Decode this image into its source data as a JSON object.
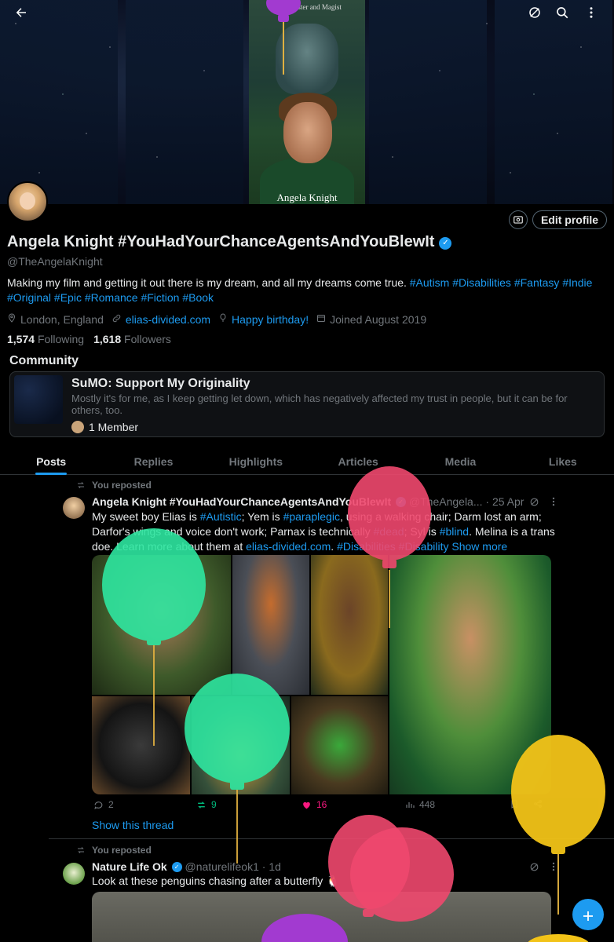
{
  "banner": {
    "book_title": "Elias\nMaster and Magist",
    "book_author": "Angela Knight"
  },
  "profile": {
    "name": "Angela Knight #YouHadYourChanceAgentsAndYouBlewIt",
    "handle": "@TheAngelaKnight",
    "edit_label": "Edit profile",
    "bio": "Making my film and getting it out there is my dream, and all my dreams come true.",
    "bio_tags": [
      "#Autism",
      "#Disabilities",
      "#Fantasy",
      "#Indie",
      "#Original",
      "#Epic",
      "#Romance",
      "#Fiction",
      "#Book"
    ],
    "location": "London, England",
    "website": "elias-divided.com",
    "birthday": "Happy birthday!",
    "joined": "Joined August 2019",
    "following_count": "1,574",
    "following_label": "Following",
    "followers_count": "1,618",
    "followers_label": "Followers"
  },
  "community": {
    "heading": "Community",
    "title": "SuMO: Support My Originality",
    "description": "Mostly it's for me, as I keep getting let down, which has negatively affected my trust in people, but it can be for others, too.",
    "members": "1 Member"
  },
  "tabs": [
    "Posts",
    "Replies",
    "Highlights",
    "Articles",
    "Media",
    "Likes"
  ],
  "posts": [
    {
      "repost_label": "You reposted",
      "author": "Angela Knight #YouHadYourChanceAgentsAndYouBlewIt",
      "handle": "@TheAngela...",
      "date": "· 25 Apr",
      "text_a": "My sweet boy Elias is ",
      "tag1": "#Autistic",
      "text_b": "; Yem is ",
      "tag2": "#paraplegic",
      "text_c": ", using a walking chair; Darm lost an arm; Darfor's wings and voice don't work; Parnax is technically ",
      "tag3": "#dead",
      "text_d": "; Syl is ",
      "tag4": "#blind",
      "text_e": ". Melina is a trans doe. Learn more about them at ",
      "link": "elias-divided.com",
      "text_f": ". ",
      "tag5": "#Disabilities",
      "tag6": "#Disability",
      "show_more": "Show more",
      "replies": "2",
      "reposts": "9",
      "likes": "16",
      "views": "448",
      "show_thread": "Show this thread"
    },
    {
      "repost_label": "You reposted",
      "author": "Nature Life Ok",
      "handle": "@naturelifeok1",
      "date": "· 1d",
      "text": "Look at these penguins chasing after a butterfly 🐧"
    }
  ],
  "colors": {
    "accent": "#1d9bf0",
    "like": "#f91880",
    "repost": "#00ba7c",
    "balloon_green": "#2ee6a0",
    "balloon_pink": "#f0486e",
    "balloon_yellow": "#f2c318",
    "balloon_purple": "#a23ad0"
  }
}
